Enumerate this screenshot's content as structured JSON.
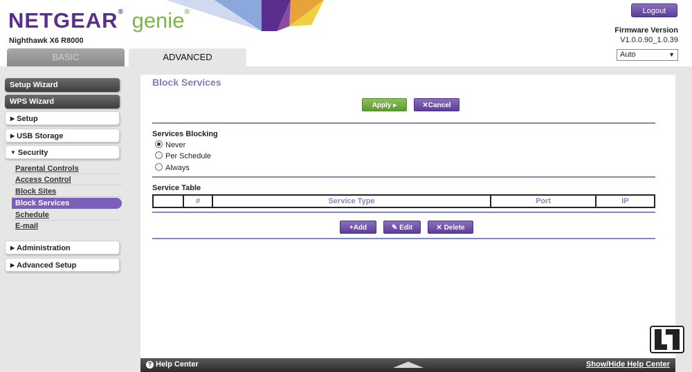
{
  "header": {
    "brand": "NETGEAR",
    "brand_reg": "®",
    "product": "genie",
    "product_reg": "®",
    "model": "Nighthawk X6 R8000",
    "logout_label": "Logout",
    "firmware_label": "Firmware Version",
    "firmware_value": "V1.0.0.90_1.0.39",
    "language_selected": "Auto",
    "tabs": [
      {
        "label": "BASIC",
        "active": false
      },
      {
        "label": "ADVANCED",
        "active": true
      }
    ]
  },
  "sidebar": {
    "setup_wizard": "Setup Wizard",
    "wps_wizard": "WPS Wizard",
    "setup": "Setup",
    "usb_storage": "USB Storage",
    "security": "Security",
    "security_items": [
      {
        "label": "Parental Controls",
        "active": false
      },
      {
        "label": "Access Control",
        "active": false
      },
      {
        "label": "Block Sites",
        "active": false
      },
      {
        "label": "Block Services",
        "active": true
      },
      {
        "label": "Schedule",
        "active": false
      },
      {
        "label": "E-mail",
        "active": false
      }
    ],
    "administration": "Administration",
    "advanced_setup": "Advanced Setup"
  },
  "main": {
    "title": "Block Services",
    "apply_label": "Apply ▸",
    "cancel_label": "Cancel",
    "blocking_heading": "Services Blocking",
    "blocking_options": [
      {
        "label": "Never",
        "checked": true
      },
      {
        "label": "Per Schedule",
        "checked": false
      },
      {
        "label": "Always",
        "checked": false
      }
    ],
    "table_heading": "Service Table",
    "table_columns": [
      "",
      "#",
      "Service Type",
      "Port",
      "IP"
    ],
    "add_label": "Add",
    "edit_label": "Edit",
    "delete_label": "Delete"
  },
  "footer": {
    "help_center": "Help Center",
    "show_hide_help": "Show/Hide Help Center"
  },
  "colors": {
    "brand_purple": "#5b2d8e",
    "genie_green": "#7ab648",
    "accent_purple": "#7b5fb8",
    "rule_blue": "#7b8bbd"
  }
}
